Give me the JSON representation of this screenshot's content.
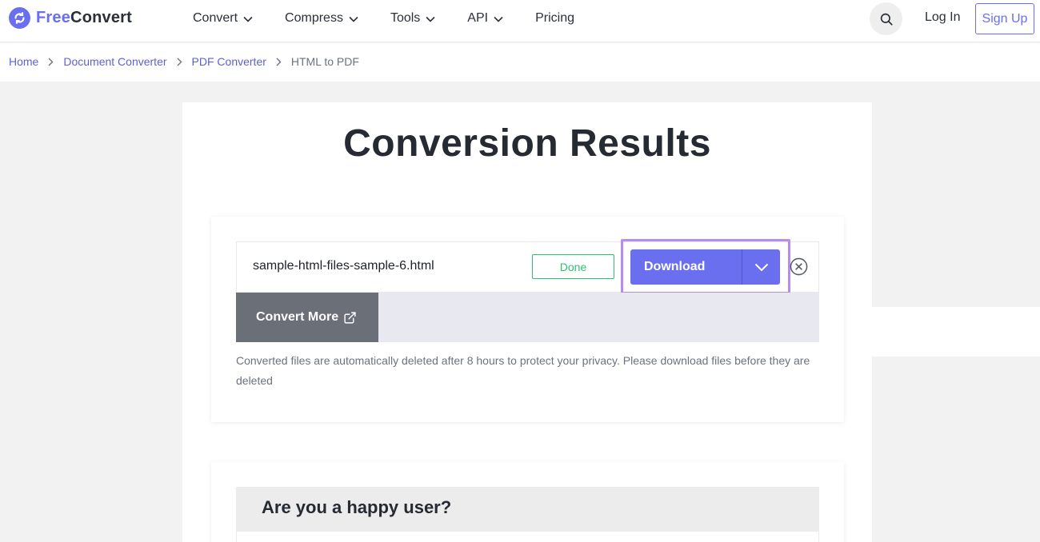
{
  "brand": {
    "free": "Free",
    "convert": "Convert"
  },
  "nav": {
    "items": [
      {
        "label": "Convert",
        "has_dropdown": true
      },
      {
        "label": "Compress",
        "has_dropdown": true
      },
      {
        "label": "Tools",
        "has_dropdown": true
      },
      {
        "label": "API",
        "has_dropdown": true
      },
      {
        "label": "Pricing",
        "has_dropdown": false
      }
    ],
    "login": "Log In",
    "signup": "Sign Up"
  },
  "breadcrumb": {
    "items": [
      "Home",
      "Document Converter",
      "PDF Converter"
    ],
    "current": "HTML to PDF"
  },
  "page": {
    "title": "Conversion Results"
  },
  "result": {
    "filename": "sample-html-files-sample-6.html",
    "status": "Done",
    "download_label": "Download",
    "convert_more_label": "Convert More",
    "note": "Converted files are automatically deleted after 8 hours to protect your privacy. Please download files before they are deleted"
  },
  "feedback": {
    "title": "Are you a happy user?"
  },
  "colors": {
    "accent": "#6a6ff0",
    "success": "#2fbf71",
    "highlight": "#b88bf0",
    "dark_button": "#6b6f78"
  }
}
